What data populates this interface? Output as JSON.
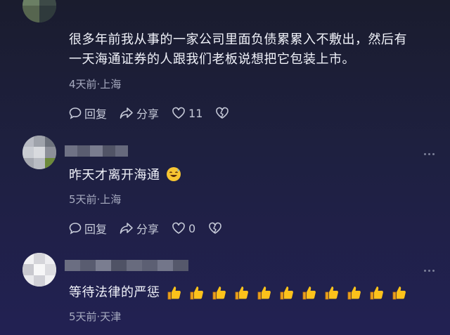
{
  "comments": [
    {
      "text_line1": "很多年前我从事的一家公司里面负债累累入不敷出，然后有",
      "text_line2": "一天海通证券的人跟我们老板说想把它包装上市。",
      "meta": "4天前·上海",
      "reply": "回复",
      "share": "分享",
      "likes": "11"
    },
    {
      "text": "昨天才离开海通",
      "emoji": "grinning-sweat-emoji",
      "meta": "5天前·上海",
      "reply": "回复",
      "share": "分享",
      "likes": "0"
    },
    {
      "text": "等待法律的严惩",
      "emoji": "thumbs-up-emoji",
      "emoji_count": 11,
      "meta": "5天前·天津"
    }
  ],
  "colors": {
    "background_top": "#1a1c2e",
    "background_bottom": "#222153",
    "text": "#f1f3fa",
    "meta": "#a7abc0",
    "action": "#c6cad8"
  }
}
